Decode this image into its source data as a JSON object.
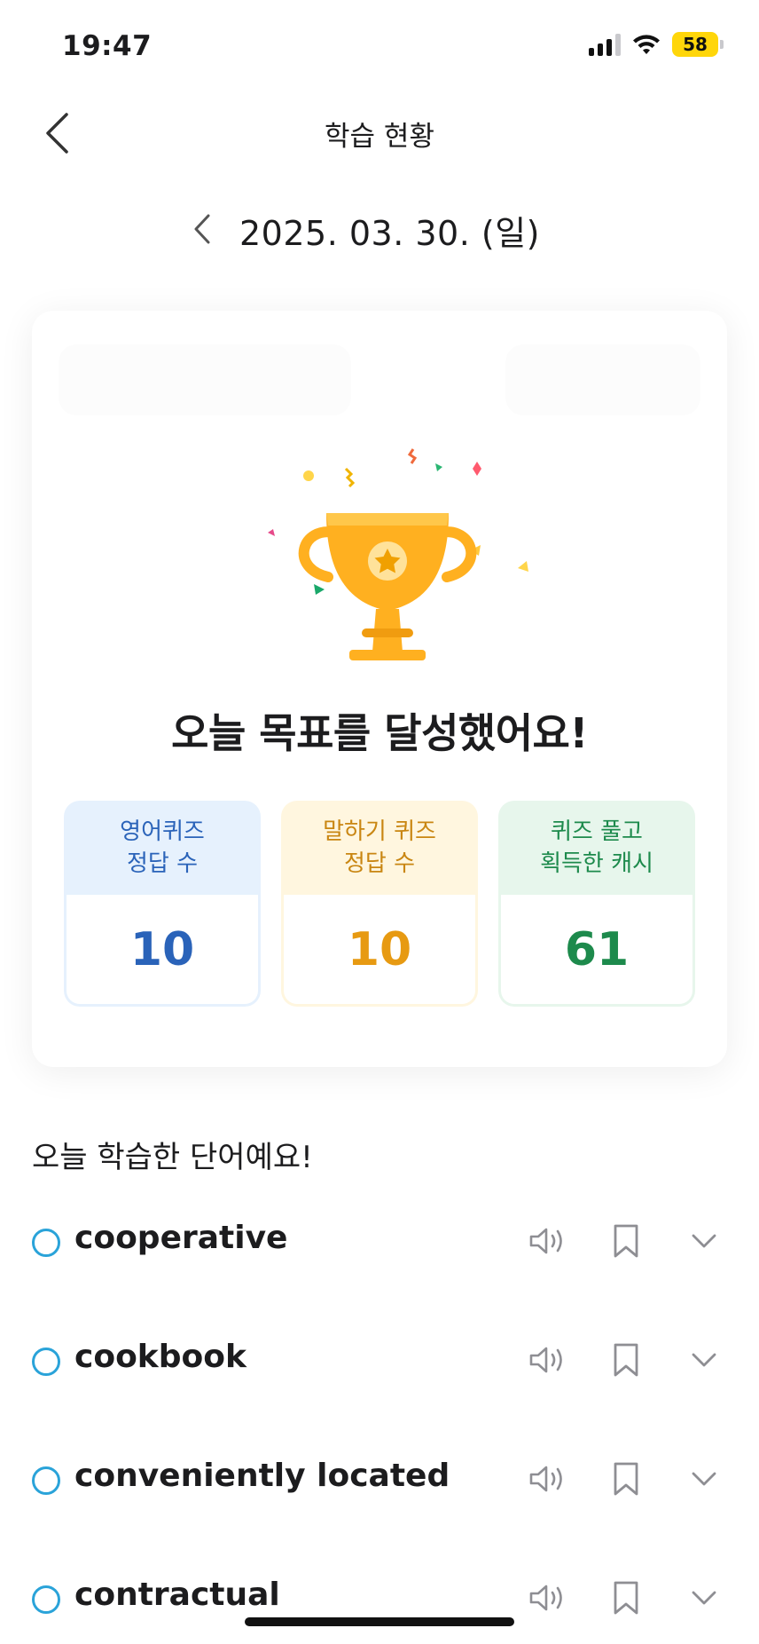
{
  "status_bar": {
    "time": "19:47",
    "battery": "58"
  },
  "header": {
    "title": "학습 현황"
  },
  "date": {
    "label": "2025. 03. 30. (일)"
  },
  "card": {
    "goal_message": "오늘 목표를 달성했어요!",
    "stats": [
      {
        "label": "영어퀴즈\n정답 수",
        "value": "10",
        "color": "#2a63b9"
      },
      {
        "label": "말하기 퀴즈\n정답 수",
        "value": "10",
        "color": "#e79a12"
      },
      {
        "label": "퀴즈 풀고\n획득한 캐시",
        "value": "61",
        "color": "#1d8a4c"
      }
    ]
  },
  "words": {
    "title": "오늘 학습한 단어예요!",
    "items": [
      {
        "word": "cooperative"
      },
      {
        "word": "cookbook"
      },
      {
        "word": "conveniently located"
      },
      {
        "word": "contractual"
      }
    ]
  },
  "icons": {
    "back": "chevron-left-icon",
    "prev_date": "chevron-left-icon",
    "speaker": "speaker-icon",
    "bookmark": "bookmark-icon",
    "expand": "chevron-down-icon"
  },
  "colors": {
    "accent": "#2aa3d9",
    "trophy": "#ffb020"
  }
}
